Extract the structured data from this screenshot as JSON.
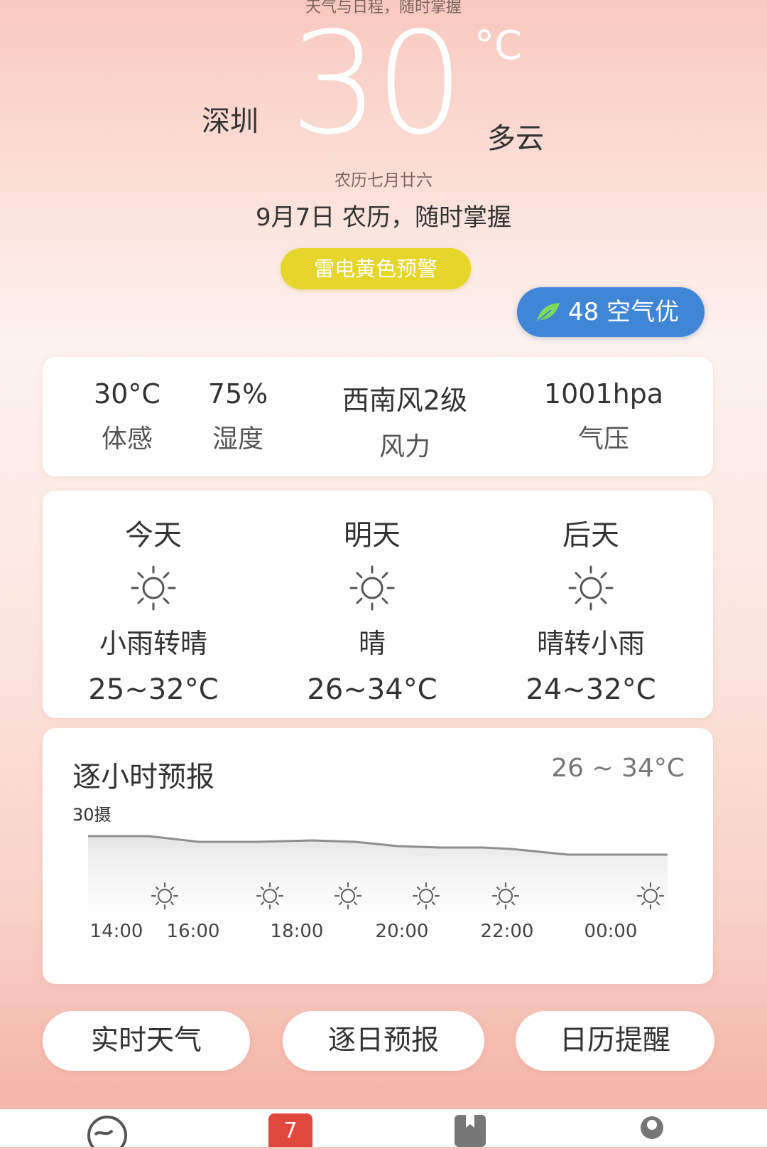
{
  "header": {
    "caption": "天气与日程，随时掌握",
    "city": "深圳",
    "temperature": "30",
    "temperature_unit": "°C",
    "condition": "多云",
    "lunar_date": "农历七月廿六",
    "date_line": "9月7日 农历，随时掌握",
    "alert": "雷电黄色预警",
    "aqi_label": "48 空气优",
    "aqi_color": "#3f86d6",
    "alert_color": "#e6d52b"
  },
  "stats": [
    {
      "value": "30°C",
      "label": "体感"
    },
    {
      "value": "75%",
      "label": "湿度"
    },
    {
      "value": "西南风2级",
      "label": "风力"
    },
    {
      "value": "1001hpa",
      "label": "气压"
    }
  ],
  "forecast": [
    {
      "day": "今天",
      "icon": "sun-icon",
      "condition": "小雨转晴",
      "range": "25~32°C"
    },
    {
      "day": "明天",
      "icon": "sun-icon",
      "condition": "晴",
      "range": "26~34°C"
    },
    {
      "day": "后天",
      "icon": "sun-icon",
      "condition": "晴转小雨",
      "range": "24~32°C"
    }
  ],
  "hourly": {
    "title": "逐小时预报",
    "range": "26 ~ 34°C",
    "y_label": "30摄",
    "hours": [
      "14:00",
      "16:00",
      "18:00",
      "20:00",
      "22:00",
      "00:00"
    ]
  },
  "buttons": {
    "realtime": "实时天气",
    "daily": "逐日预报",
    "calendar": "日历提醒"
  },
  "tabbar": {
    "calendar_day": "7"
  }
}
